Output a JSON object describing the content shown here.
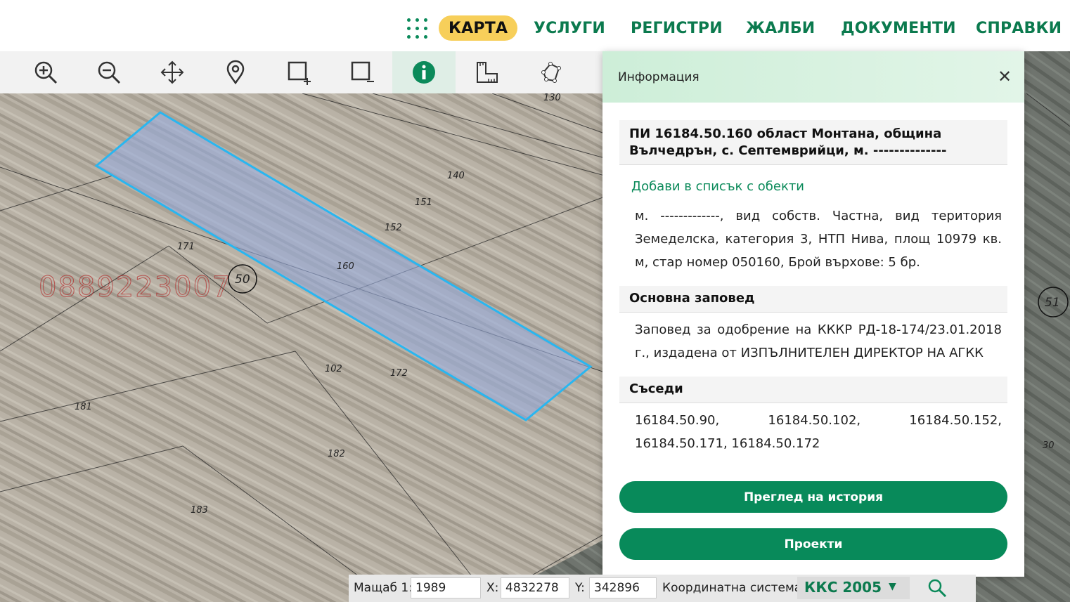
{
  "nav": {
    "items": [
      {
        "label": "КАРТА",
        "active": true
      },
      {
        "label": "УСЛУГИ"
      },
      {
        "label": "РЕГИСТРИ"
      },
      {
        "label": "ЖАЛБИ"
      },
      {
        "label": "ДОКУМЕНТИ"
      },
      {
        "label": "СПРАВКИ"
      }
    ]
  },
  "toolbar": {
    "tools": [
      "zoom-in-icon",
      "zoom-out-icon",
      "pan-icon",
      "location-pin-icon",
      "select-add-icon",
      "select-remove-icon",
      "info-icon",
      "measure-icon",
      "polygon-icon"
    ],
    "active_tool": "info-icon"
  },
  "map": {
    "labels": [
      "130",
      "140",
      "151",
      "152",
      "171",
      "160",
      "50",
      "102",
      "172",
      "181",
      "182",
      "183",
      "51",
      "30"
    ],
    "watermark": "0889223007"
  },
  "panel": {
    "title": "Информация",
    "parcel_title": "ПИ 16184.50.160 област Монтана, община Вълчедрън, с. Септемврийци, м. --------------",
    "add_link": "Добави в списък с обекти",
    "description": "м. -------------, вид собств. Частна, вид територия Земеделска, категория 3, НТП Нива, площ 10979 кв. м, стар номер 050160, Брой върхове: 5 бр.",
    "order_head": "Основна заповед",
    "order_text": "Заповед за одобрение на КККР РД-18-174/23.01.2018 г., издадена от ИЗПЪЛНИТЕЛЕН ДИРЕКТОР НА АГКК",
    "neighbors_head": "Съседи",
    "neighbors_text": "16184.50.90, 16184.50.102, 16184.50.152, 16184.50.171, 16184.50.172",
    "history_button": "Преглед на история",
    "projects_button": "Проекти"
  },
  "status": {
    "scale_label": "Мащаб 1:",
    "scale_value": "1989",
    "x_label": "X:",
    "x_value": "4832278",
    "y_label": "Y:",
    "y_value": "342896",
    "crs_label": "Координатна система:",
    "crs_value": "ККС 2005"
  },
  "colors": {
    "accent": "#088a5a",
    "active_nav": "#f7cf5a",
    "parcel_outline": "#29b6f0"
  }
}
